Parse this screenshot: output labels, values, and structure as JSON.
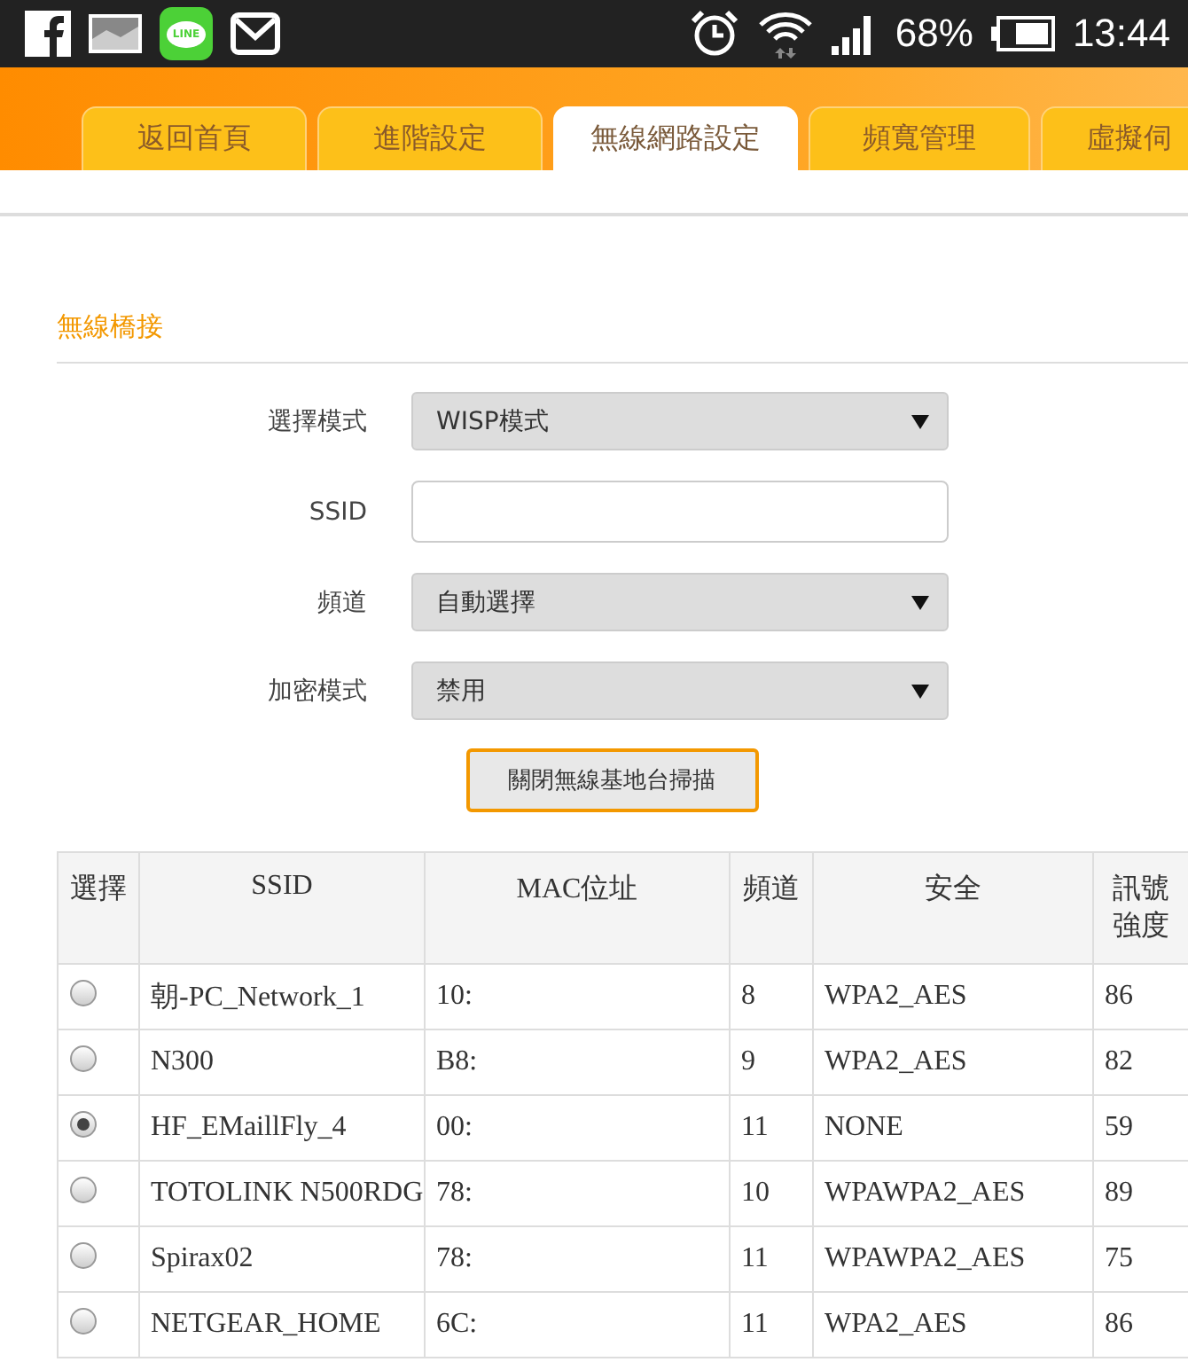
{
  "status_bar": {
    "line_label": "LINE",
    "battery": "68%",
    "time": "13:44"
  },
  "tabs": [
    {
      "label": "返回首頁",
      "selected": false
    },
    {
      "label": "進階設定",
      "selected": false
    },
    {
      "label": "無線網路設定",
      "selected": true
    },
    {
      "label": "頻寬管理",
      "selected": false
    },
    {
      "label": "虛擬伺",
      "selected": false
    }
  ],
  "section": {
    "title": "無線橋接"
  },
  "form": [
    {
      "label": "選擇模式",
      "kind": "select",
      "value": "WISP模式"
    },
    {
      "label": "SSID",
      "kind": "text"
    },
    {
      "label": "頻道",
      "kind": "select",
      "value": "自動選擇"
    },
    {
      "label": "加密模式",
      "kind": "select",
      "value": "禁用"
    }
  ],
  "scan_button": "關閉無線基地台掃描",
  "table": {
    "columns": [
      "選擇",
      "SSID",
      "MAC位址",
      "頻道",
      "安全",
      "訊號強度"
    ],
    "rows": [
      {
        "selected": false,
        "ssid": "朝-PC_Network_1",
        "mac": "10:",
        "channel": "8",
        "security": "WPA2_AES",
        "signal": "86"
      },
      {
        "selected": false,
        "ssid": "N300",
        "mac": "B8:",
        "channel": "9",
        "security": "WPA2_AES",
        "signal": "82"
      },
      {
        "selected": true,
        "ssid": "HF_EMaillFly_4",
        "mac": "00:",
        "channel": "11",
        "security": "NONE",
        "signal": "59"
      },
      {
        "selected": false,
        "ssid": "TOTOLINK N500RDG",
        "mac": "78:",
        "channel": "10",
        "security": "WPAWPA2_AES",
        "signal": "89"
      },
      {
        "selected": false,
        "ssid": "Spirax02",
        "mac": "78:",
        "channel": "11",
        "security": "WPAWPA2_AES",
        "signal": "75"
      },
      {
        "selected": false,
        "ssid": "NETGEAR_HOME",
        "mac": "6C:",
        "channel": "11",
        "security": "WPA2_AES",
        "signal": "86"
      }
    ]
  }
}
